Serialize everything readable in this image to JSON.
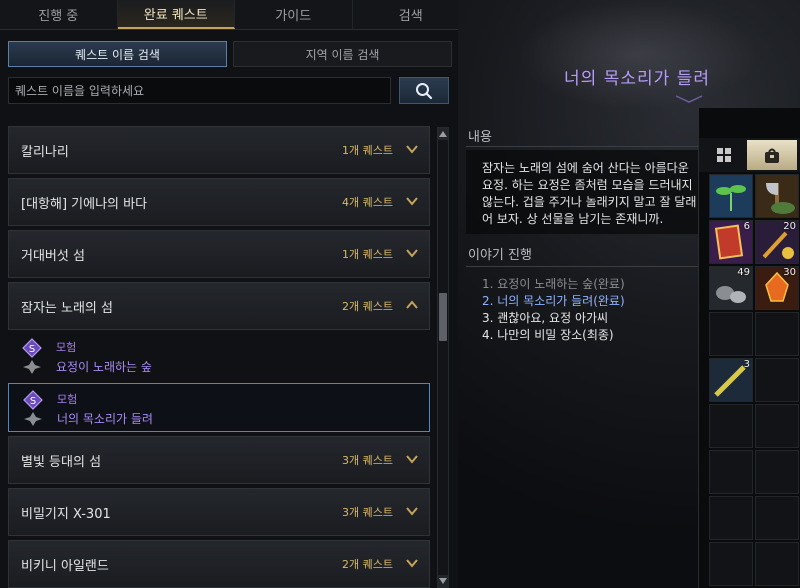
{
  "top_tabs": {
    "in_progress": "진행 중",
    "completed": "완료 퀘스트",
    "guide": "가이드",
    "search": "검색"
  },
  "search_tabs": {
    "by_quest": "퀘스트 이름 검색",
    "by_region": "지역 이름 검색"
  },
  "search": {
    "placeholder": "퀘스트 이름을 입력하세요"
  },
  "categories": [
    {
      "name": "칼리나리",
      "count": "1개 퀘스트"
    },
    {
      "name": "[대항해] 기에나의 바다",
      "count": "4개 퀘스트"
    },
    {
      "name": "거대버섯 섬",
      "count": "1개 퀘스트"
    },
    {
      "name": "잠자는 노래의 섬",
      "count": "2개 퀘스트"
    },
    {
      "name": "별빛 등대의 섬",
      "count": "3개 퀘스트"
    },
    {
      "name": "비밀기지 X-301",
      "count": "3개 퀘스트"
    },
    {
      "name": "비키니 아일랜드",
      "count": "2개 퀘스트"
    }
  ],
  "sub_quests": [
    {
      "type": "모험",
      "name": "요정이 노래하는 숲"
    },
    {
      "type": "모험",
      "name": "너의 목소리가 들려"
    }
  ],
  "detail": {
    "title": "너의 목소리가 들려",
    "content_label": "내용",
    "description": "잠자는 노래의 섬에 숨어 산다는 아름다운 요정. 하는 요정은 좀처럼 모습을 드러내지 않는다. 겁을 주거나 놀래키지 말고 잘 달래어 보자. 상 선물을 남기는 존재니까.",
    "story_label": "이야기 진행",
    "story": [
      "1. 요정이 노래하는 숲(완료)",
      "2. 너의 목소리가 들려(완료)",
      "3. 괜찮아요, 요정 아가씨",
      "4. 나만의 비밀 장소(최종)"
    ]
  },
  "inventory": {
    "counts": [
      "6",
      "20",
      "49",
      "30",
      "3"
    ]
  },
  "colors": {
    "accent_gold": "#d9b968",
    "quest_purple": "#a98af4",
    "selected_border": "#4f86c6",
    "story_current": "#8fb3ff"
  }
}
